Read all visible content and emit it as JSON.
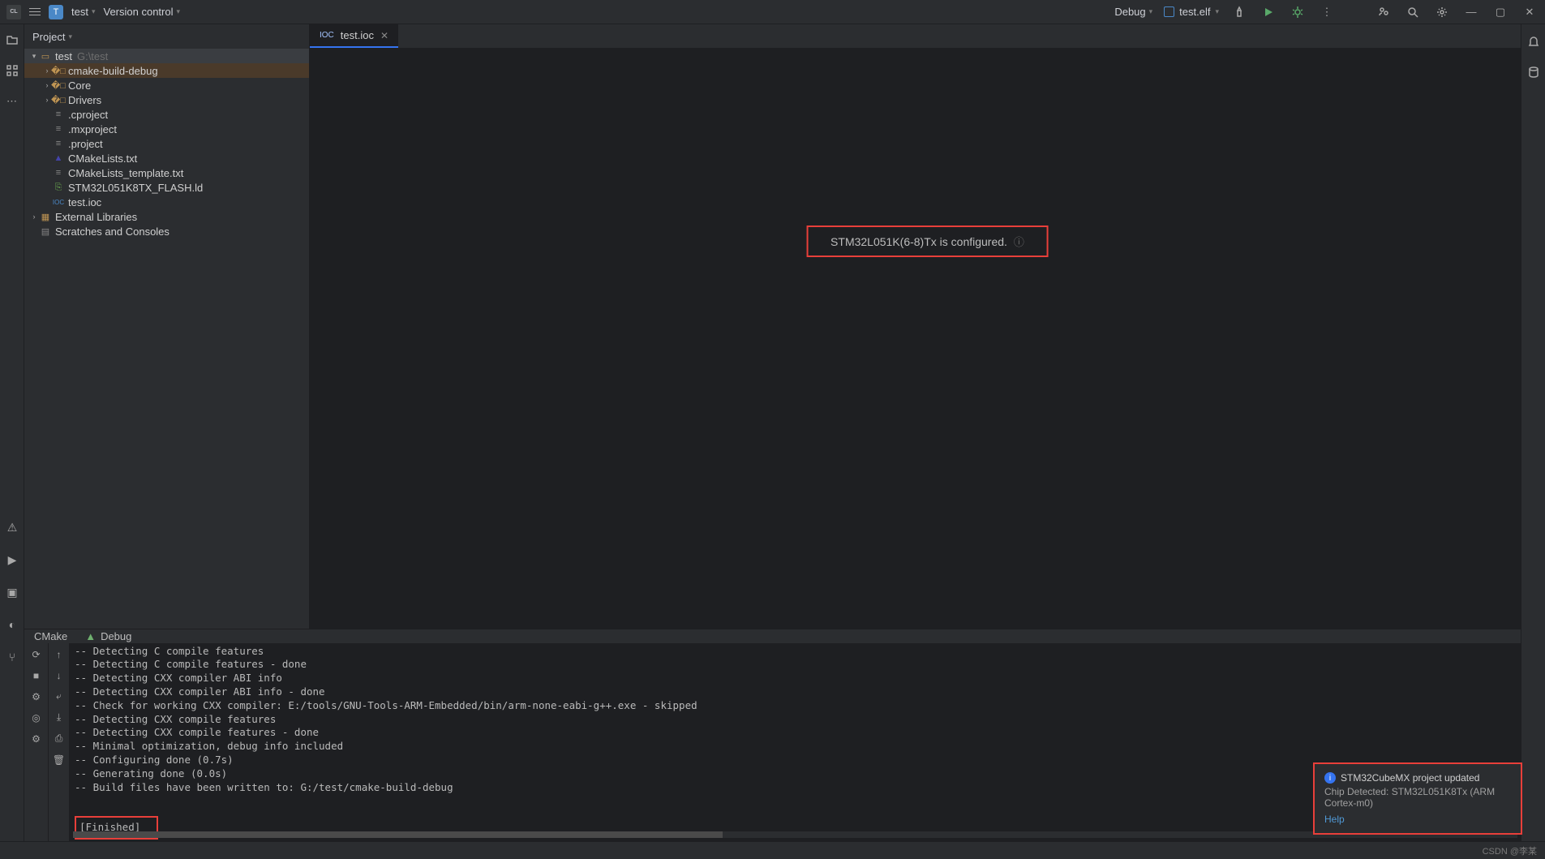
{
  "titlebar": {
    "project_name": "test",
    "vcs_label": "Version control",
    "run_mode": "Debug",
    "run_config": "test.elf"
  },
  "sidebar": {
    "title": "Project"
  },
  "tree": {
    "root": {
      "name": "test",
      "path": "G:\\test"
    },
    "children": [
      {
        "name": "cmake-build-debug",
        "kind": "folder",
        "expandable": true,
        "selected": true
      },
      {
        "name": "Core",
        "kind": "folder",
        "expandable": true
      },
      {
        "name": "Drivers",
        "kind": "folder",
        "expandable": true
      },
      {
        "name": ".cproject",
        "kind": "file"
      },
      {
        "name": ".mxproject",
        "kind": "file"
      },
      {
        "name": ".project",
        "kind": "file"
      },
      {
        "name": "CMakeLists.txt",
        "kind": "cmake"
      },
      {
        "name": "CMakeLists_template.txt",
        "kind": "file"
      },
      {
        "name": "STM32L051K8TX_FLASH.ld",
        "kind": "ld"
      },
      {
        "name": "test.ioc",
        "kind": "ioc"
      }
    ],
    "external": "External Libraries",
    "scratches": "Scratches and Consoles"
  },
  "tabs": {
    "active": "test.ioc"
  },
  "editor": {
    "message": "STM32L051K(6-8)Tx is configured."
  },
  "bottom_tabs": {
    "cmake": "CMake",
    "debug": "Debug"
  },
  "console_lines": [
    "-- Detecting C compile features",
    "-- Detecting C compile features - done",
    "-- Detecting CXX compiler ABI info",
    "-- Detecting CXX compiler ABI info - done",
    "-- Check for working CXX compiler: E:/tools/GNU-Tools-ARM-Embedded/bin/arm-none-eabi-g++.exe - skipped",
    "-- Detecting CXX compile features",
    "-- Detecting CXX compile features - done",
    "-- Minimal optimization, debug info included",
    "-- Configuring done (0.7s)",
    "-- Generating done (0.0s)",
    "-- Build files have been written to: G:/test/cmake-build-debug"
  ],
  "console_finished": "[Finished]",
  "toast": {
    "title": "STM32CubeMX project updated",
    "body": "Chip Detected: STM32L051K8Tx (ARM Cortex-m0)",
    "help": "Help"
  },
  "watermark": "CSDN @李某"
}
